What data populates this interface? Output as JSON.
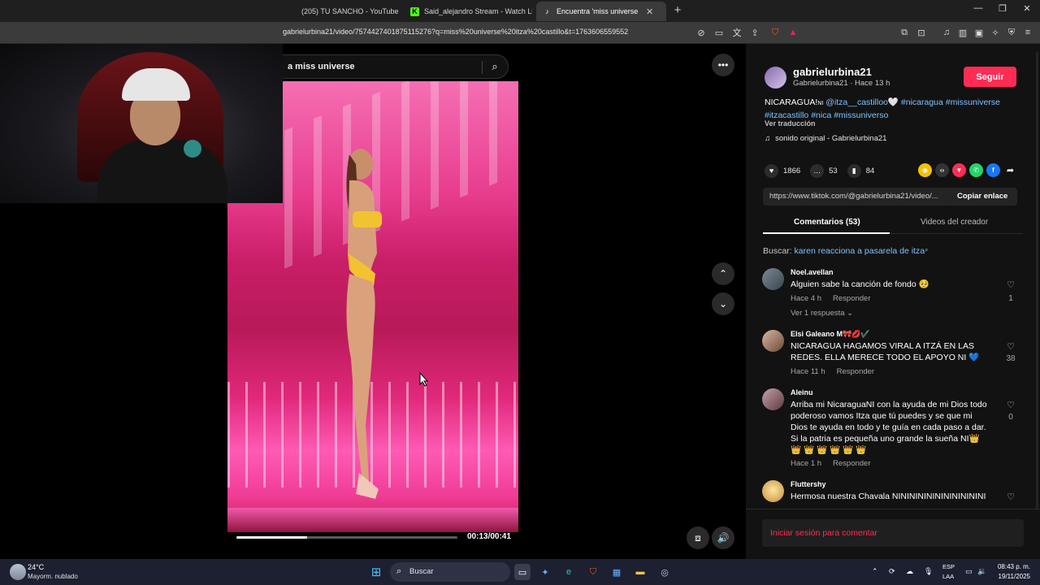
{
  "browser": {
    "tabs": [
      {
        "label": "(205) TU SANCHO - YouTube",
        "active": false
      },
      {
        "label": "Said_alejandro Stream - Watch Live o",
        "active": false
      },
      {
        "label": "Encuentra 'miss universe itza",
        "active": true
      }
    ],
    "url": "gabrielurbina21/video/7574427401875115276?q=miss%20universe%20itza%20castillo&t=1763606559552"
  },
  "video": {
    "search_query": "a miss universe",
    "progress_fraction": 0.32,
    "time": "00:13/00:41"
  },
  "panel": {
    "username": "gabrielurbina21",
    "subtitle": "Gabrielurbina21 · Hace 13 h",
    "follow_label": "Seguir",
    "desc_line1_text": "NICARAGUA!",
    "desc_flag1": "NI",
    "desc_mention": "@itza__castilloo",
    "desc_heart": "🤍",
    "desc_tags1": "#nicaragua #missuniverse",
    "desc_tags2": "#itzacastillo #nica #missuniverso",
    "translate_label": "Ver traducción",
    "music": "sonido original - Gabrielurbina21",
    "likes": "1866",
    "comments": "53",
    "saves": "84",
    "link_url": "https://www.tiktok.com/@gabrielurbina21/video/...",
    "copy_label": "Copiar enlace",
    "tab_comments": "Comentarios (53)",
    "tab_videos": "Videos del creador",
    "search_label": "Buscar:",
    "search_link": "karen reacciona a pasarela de itza",
    "login_label": "Iniciar sesión para comentar"
  },
  "comments": [
    {
      "name": "Noel.avellan",
      "text": "Alguien sabe la canción de fondo 🥺",
      "time": "Hace 4 h",
      "reply": "Responder",
      "likes": "1",
      "view_replies": "Ver 1 respuesta ⌄"
    },
    {
      "name": "Elsi Galeano M🎀💋✔️",
      "text": "NICARAGUA HAGAMOS VIRAL A ITZÁ EN LAS REDES. ELLA MERECE TODO EL APOYO NI 💙",
      "time": "Hace 11 h",
      "reply": "Responder",
      "likes": "38"
    },
    {
      "name": "Aleinu",
      "text": "Arriba mi NicaraguaNI con la ayuda de mi Dios todo poderoso vamos Itza que tú puedes y se que mi Dios te ayuda en todo y te guía en cada paso a dar. Si la patria es pequeña uno grande la sueña NI👑 👑 👑 👑 👑 👑 👑",
      "time": "Hace 1 h",
      "reply": "Responder",
      "likes": "0"
    },
    {
      "name": "Fluttershy",
      "text": "Hermosa nuestra Chavala NININININININININININI",
      "time": "",
      "reply": "",
      "likes": ""
    }
  ],
  "taskbar": {
    "temp": "24°C",
    "weather": "Mayorm. nublado",
    "search": "Buscar",
    "lang1": "ESP",
    "lang2": "LAA",
    "time": "08:43 p. m.",
    "date": "19/11/2025"
  },
  "colors": {
    "accent": "#fe2c55",
    "link": "#7ec3ff",
    "panel_bg": "#121212"
  }
}
